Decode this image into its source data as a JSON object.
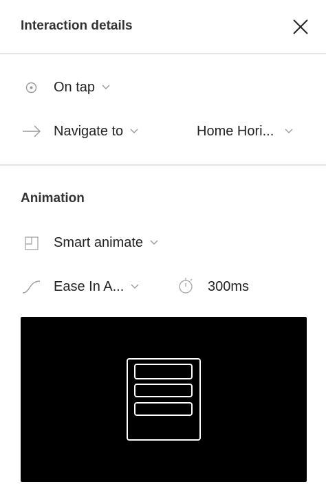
{
  "header": {
    "title": "Interaction details"
  },
  "trigger": {
    "label": "On tap"
  },
  "action": {
    "label": "Navigate to",
    "destination": "Home Hori..."
  },
  "animation": {
    "heading": "Animation",
    "type": "Smart animate",
    "easing": "Ease In A...",
    "duration": "300ms"
  }
}
